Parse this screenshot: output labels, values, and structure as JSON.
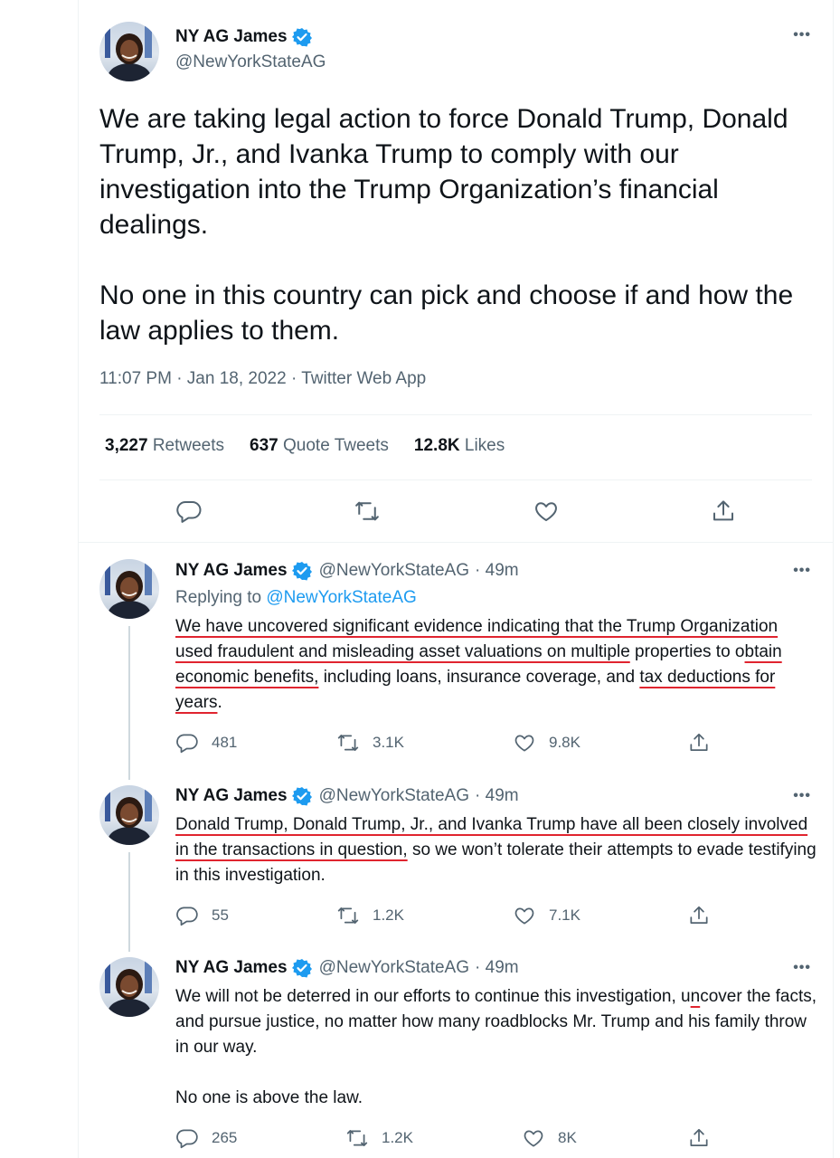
{
  "account": {
    "name": "NY AG James",
    "handle": "@NewYorkStateAG"
  },
  "main_tweet": {
    "text": "We are taking legal action to force Donald Trump, Donald Trump, Jr., and Ivanka Trump to comply with our investigation into the Trump Organization’s financial dealings.\n\nNo one in this country can pick and choose if and how the law applies to them.",
    "meta": "11:07 PM · Jan 18, 2022 · Twitter Web App",
    "retweets_count": "3,227",
    "retweets_label": "Retweets",
    "quotes_count": "637",
    "quotes_label": "Quote Tweets",
    "likes_count": "12.8K",
    "likes_label": "Likes",
    "more": "•••"
  },
  "replies": [
    {
      "time": "· 49m",
      "replying_prefix": "Replying to",
      "replying_to": "@NewYorkStateAG",
      "segments": [
        {
          "t": "We have uncovered significant evidence indicating that the Trump Organization used fraudulent and misleading asset valuations on multiple",
          "u": true
        },
        {
          "t": " properties to o",
          "u": false
        },
        {
          "t": "btain economic benefits,",
          "u": true
        },
        {
          "t": " including loans, insurance coverage, and ",
          "u": false
        },
        {
          "t": "tax deductions for years",
          "u": true
        },
        {
          "t": ".",
          "u": false
        }
      ],
      "replies": "481",
      "retweets": "3.1K",
      "likes": "9.8K"
    },
    {
      "time": "· 49m",
      "segments": [
        {
          "t": "Donald Trump, Donald Trump, Jr., and Ivanka Trump have all been closely involved in the transactions in question,",
          "u": true
        },
        {
          "t": " so we won’t tolerate their attempts to evade testifying in this investigation.",
          "u": false
        }
      ],
      "replies": "55",
      "retweets": "1.2K",
      "likes": "7.1K"
    },
    {
      "time": "· 49m",
      "segments": [
        {
          "t": "We will not be deterred in our efforts to continue this investigation, u",
          "u": false
        },
        {
          "t": "n",
          "u": true
        },
        {
          "t": "cover the facts, and pursue justice, no matter how many roadblocks Mr. Trump and his family throw in our way.",
          "u": false
        }
      ],
      "text_extra": "No one is above the law.",
      "replies": "265",
      "retweets": "1.2K",
      "likes": "8K"
    }
  ],
  "colors": {
    "verified": "#1d9bf0",
    "underline": "#e0242f",
    "secondary_text": "#536471"
  }
}
